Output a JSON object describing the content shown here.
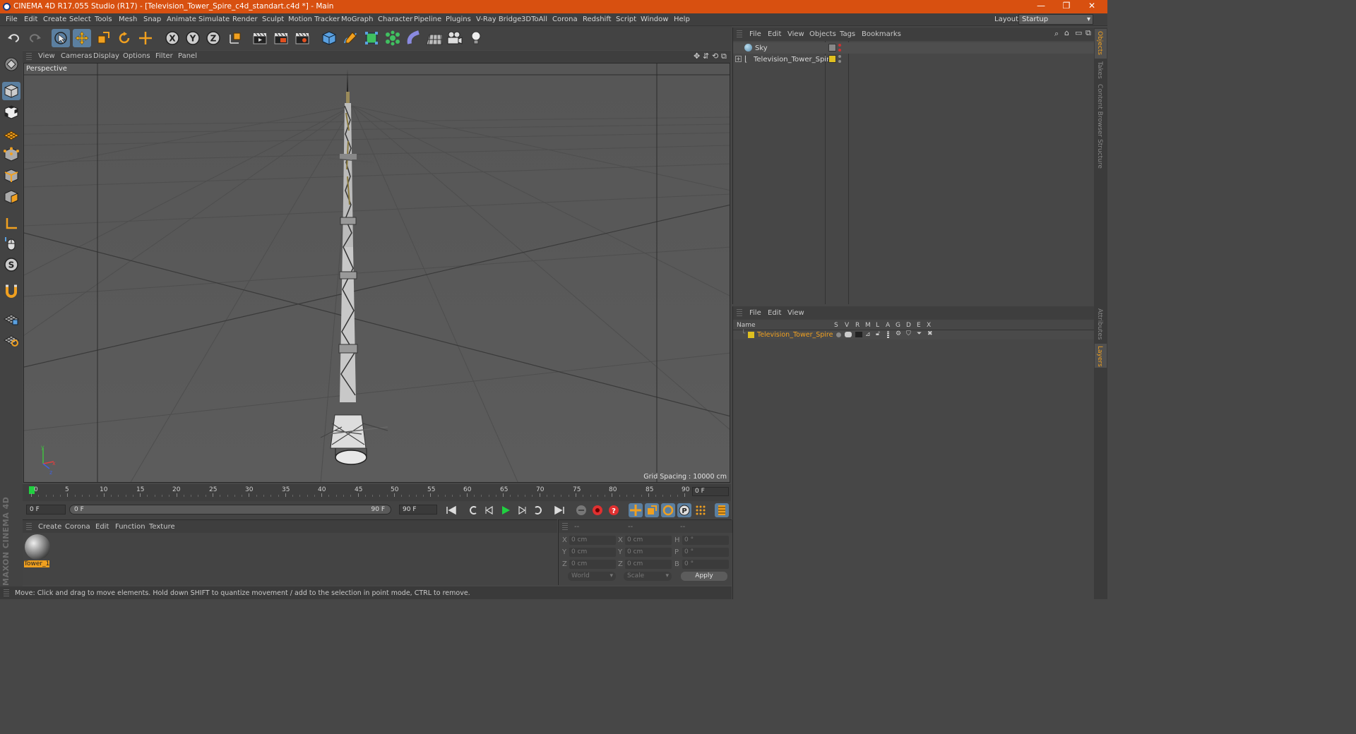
{
  "window": {
    "title": "CINEMA 4D R17.055 Studio (R17) - [Television_Tower_Spire_c4d_standart.c4d *] - Main"
  },
  "menu": [
    "File",
    "Edit",
    "Create",
    "Select",
    "Tools",
    "Mesh",
    "Snap",
    "Animate",
    "Simulate",
    "Render",
    "Sculpt",
    "Motion Tracker",
    "MoGraph",
    "Character",
    "Pipeline",
    "Plugins",
    "V-Ray Bridge",
    "3DToAll",
    "Corona",
    "Redshift",
    "Script",
    "Window",
    "Help"
  ],
  "layout": {
    "label": "Layout:",
    "value": "Startup"
  },
  "viewport": {
    "menu": [
      "View",
      "Cameras",
      "Display",
      "Options",
      "Filter",
      "Panel"
    ],
    "camera": "Perspective",
    "grid_spacing": "Grid Spacing : 10000 cm"
  },
  "timeline": {
    "ticks": [
      "0",
      "5",
      "10",
      "15",
      "20",
      "25",
      "30",
      "35",
      "40",
      "45",
      "50",
      "55",
      "60",
      "65",
      "70",
      "75",
      "80",
      "85",
      "90"
    ],
    "current_frame": "0 F"
  },
  "transport": {
    "start": "0 F",
    "range_start": "0 F",
    "range_end": "90 F",
    "end": "90 F"
  },
  "material_panel": {
    "menu": [
      "Create",
      "Corona",
      "Edit",
      "Function",
      "Texture"
    ],
    "materials": [
      {
        "name": "Tower_1"
      }
    ]
  },
  "coords": {
    "headers": [
      "--",
      "--",
      "--"
    ],
    "rows": [
      {
        "a": "X",
        "av": "0 cm",
        "b": "X",
        "bv": "0 cm",
        "c": "H",
        "cv": "0 °"
      },
      {
        "a": "Y",
        "av": "0 cm",
        "b": "Y",
        "bv": "0 cm",
        "c": "P",
        "cv": "0 °"
      },
      {
        "a": "Z",
        "av": "0 cm",
        "b": "Z",
        "bv": "0 cm",
        "c": "B",
        "cv": "0 °"
      }
    ],
    "mode1": "World",
    "mode2": "Scale",
    "apply": "Apply"
  },
  "status": "Move: Click and drag to move elements. Hold down SHIFT to quantize movement / add to the selection in point mode, CTRL to remove.",
  "objects_panel": {
    "menu": [
      "File",
      "Edit",
      "View",
      "Objects",
      "Tags",
      "Bookmarks"
    ],
    "items": [
      {
        "name": "Sky",
        "tag_color": "#cc3333"
      },
      {
        "name": "Television_Tower_Spire",
        "tag_color": "#e0c020"
      }
    ]
  },
  "layers_panel": {
    "menu": [
      "File",
      "Edit",
      "View"
    ],
    "columns": [
      "Name",
      "S",
      "V",
      "R",
      "M",
      "L",
      "A",
      "G",
      "D",
      "E",
      "X"
    ],
    "items": [
      {
        "name": "Television_Tower_Spire",
        "color": "#e0c020"
      }
    ]
  },
  "side_tabs": [
    "Objects",
    "Takes",
    "Content Browser",
    "Structure",
    "Attributes",
    "Layers"
  ],
  "brand": "MAXON CINEMA 4D"
}
